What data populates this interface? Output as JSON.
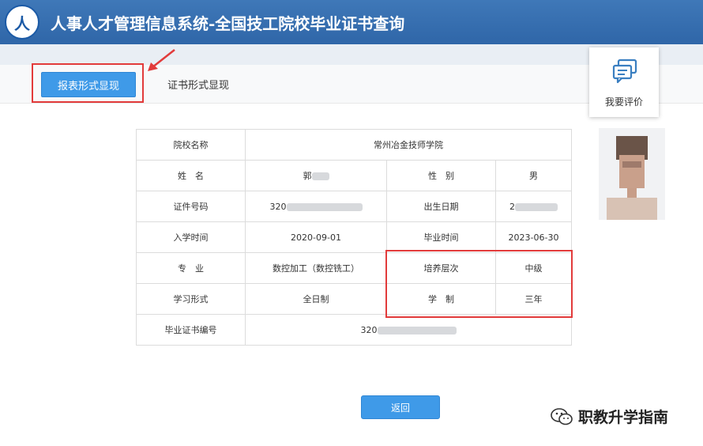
{
  "header": {
    "logo_text": "人",
    "title": "人事人才管理信息系统-全国技工院校毕业证书查询"
  },
  "tabs": {
    "report_view": "报表形式显现",
    "certificate_view": "证书形式显现"
  },
  "review": {
    "label": "我要评价",
    "icon": "chat-bubbles-icon"
  },
  "table": {
    "school_label": "院校名称",
    "school_value": "常州冶金技师学院",
    "name_label": "姓　名",
    "name_value": "郭",
    "gender_label": "性　别",
    "gender_value": "男",
    "id_label": "证件号码",
    "id_value": "320",
    "birth_label": "出生日期",
    "birth_value": "2",
    "enroll_label": "入学时间",
    "enroll_value": "2020-09-01",
    "grad_label": "毕业时间",
    "grad_value": "2023-06-30",
    "major_label": "专　业",
    "major_value": "数控加工（数控铣工）",
    "level_label": "培养层次",
    "level_value": "中级",
    "mode_label": "学习形式",
    "mode_value": "全日制",
    "duration_label": "学　制",
    "duration_value": "三年",
    "cert_no_label": "毕业证书编号",
    "cert_no_value": "320"
  },
  "back_button": "返回",
  "watermark": {
    "text": "职教升学指南",
    "icon": "wechat-icon"
  },
  "colors": {
    "header": "#2f66a8",
    "button": "#3f9ae8",
    "highlight": "#e23b3b"
  }
}
